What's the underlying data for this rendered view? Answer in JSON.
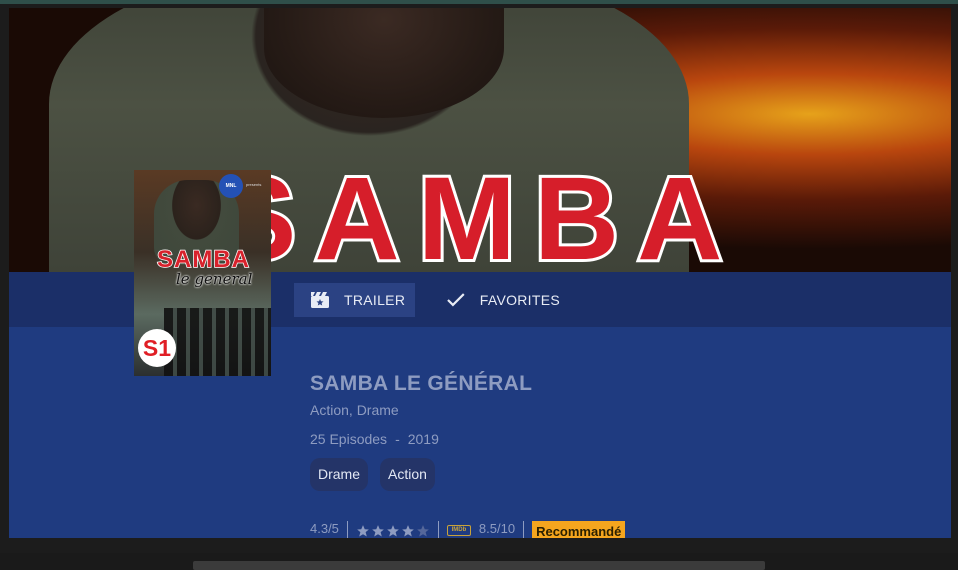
{
  "hero": {
    "title": "SAMBA"
  },
  "poster": {
    "title": "SAMBA",
    "subtitle": "le general",
    "badge": "MNL",
    "presents": "presents",
    "season_badge": "S1"
  },
  "actions": {
    "trailer_label": "TRAILER",
    "favorites_label": "FAVORITES"
  },
  "details": {
    "title": "SAMBA LE GÉNÉRAL",
    "genres": "Action, Drame",
    "episodes": "25 Episodes",
    "separator": "-",
    "year": "2019",
    "tags": [
      "Drame",
      "Action"
    ]
  },
  "rating": {
    "score": "4.3/5",
    "stars_filled": 4,
    "stars_total": 5,
    "imdb_icon_text": "IMDb",
    "imdb_score": "8.5/10",
    "recommended_label": "Recommandé"
  },
  "colors": {
    "panel": "#1f3b80",
    "action_bar": "#1b2f68",
    "accent_badge": "#f5a51e",
    "star_filled": "#8e9cc1",
    "star_empty": "#55679a",
    "hero_title_red": "#d61e2a"
  },
  "icons": {
    "trailer": "movie-clapper-icon",
    "favorites": "check-icon",
    "star": "star-icon",
    "imdb": "imdb-icon"
  }
}
